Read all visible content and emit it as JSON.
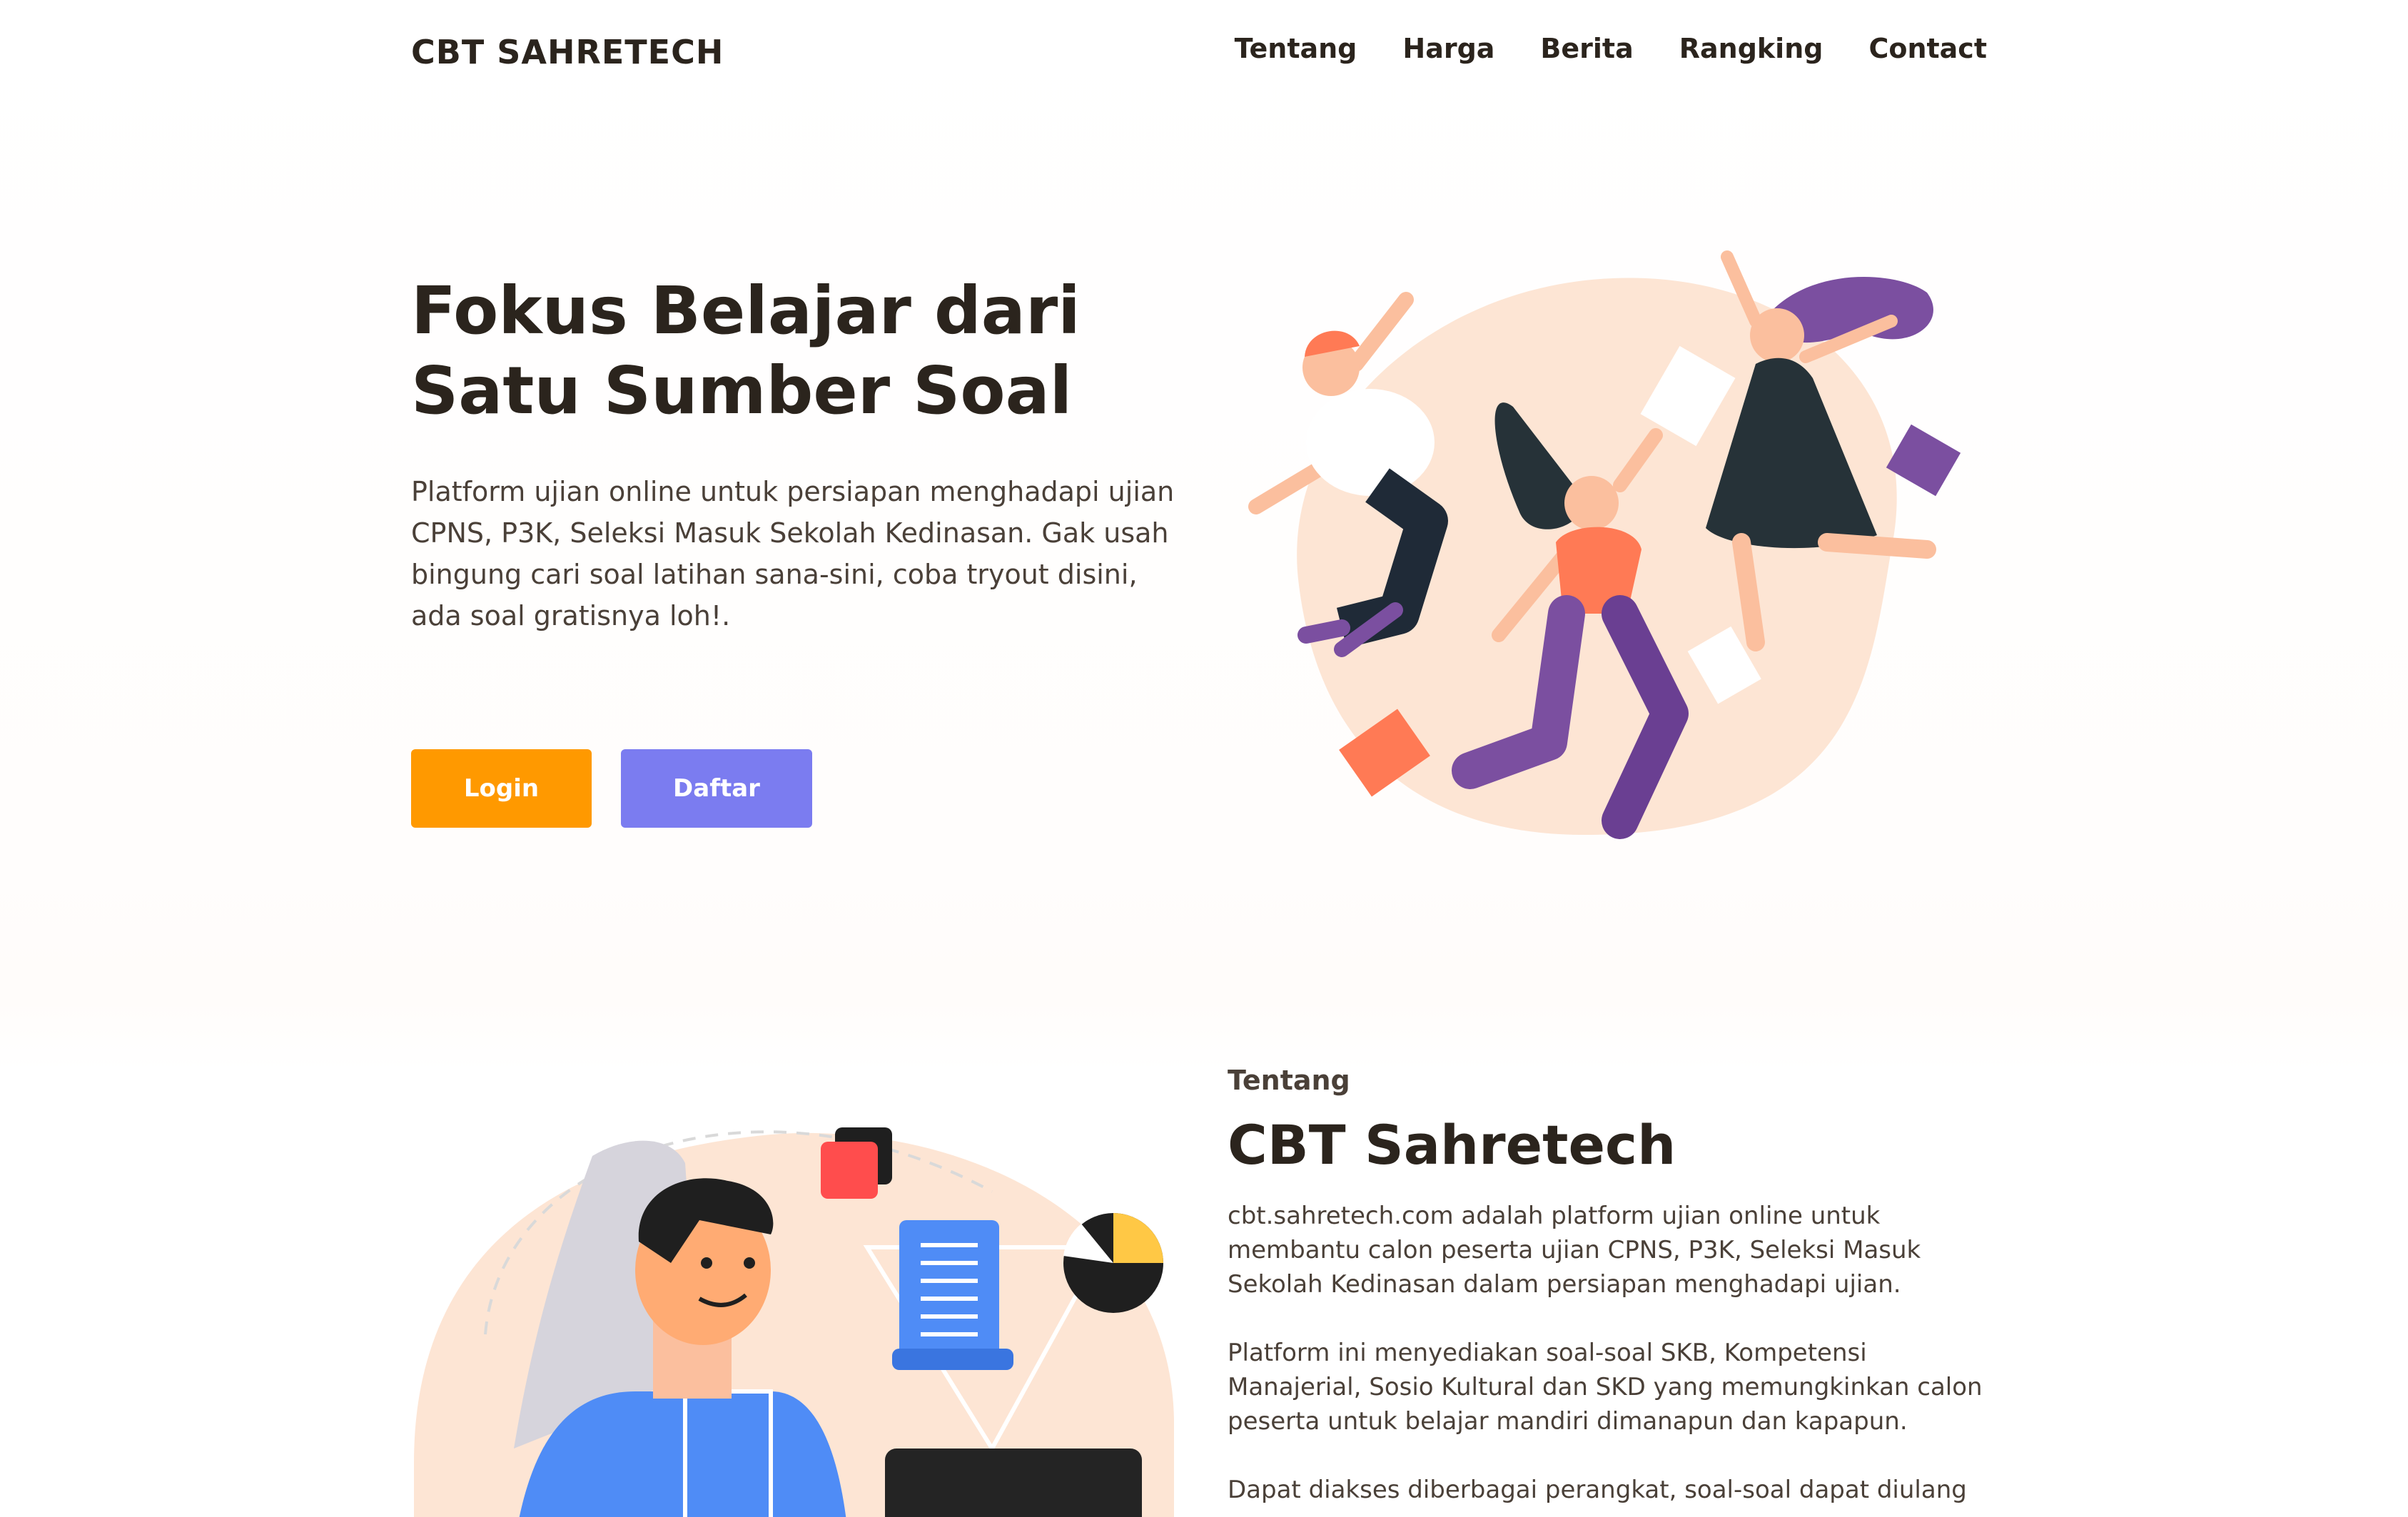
{
  "header": {
    "brand": "CBT SAHRETECH",
    "nav": [
      {
        "label": "Tentang"
      },
      {
        "label": "Harga"
      },
      {
        "label": "Berita"
      },
      {
        "label": "Rangking"
      },
      {
        "label": "Contact"
      }
    ]
  },
  "hero": {
    "title_line1": "Fokus Belajar dari",
    "title_line2": "Satu Sumber Soal",
    "description": "Platform ujian online untuk persiapan menghadapi ujian CPNS, P3K, Seleksi Masuk Sekolah Kedinasan. Gak usah bingung cari soal latihan sana-sini, coba tryout disini, ada soal gratisnya loh!.",
    "login_label": "Login",
    "register_label": "Daftar"
  },
  "about": {
    "kicker": "Tentang",
    "title": "CBT Sahretech",
    "paragraph1": "cbt.sahretech.com adalah platform ujian online untuk membantu calon peserta ujian CPNS, P3K, Seleksi Masuk Sekolah Kedinasan dalam persiapan menghadapi ujian.",
    "paragraph2": "Platform ini menyediakan soal-soal SKB, Kompetensi Manajerial, Sosio Kultural dan SKD yang memungkinkan calon peserta untuk belajar mandiri dimanapun dan kapapun.",
    "paragraph3": "Dapat diakses diberbagai perangkat, soal-soal dapat diulang"
  },
  "colors": {
    "text_dark": "#2b241d",
    "login_button": "#ff9900",
    "register_button": "#7b7cf0",
    "illustration_blob": "#fde8d8",
    "purple": "#7b4fa0",
    "coral": "#ff7a55"
  }
}
